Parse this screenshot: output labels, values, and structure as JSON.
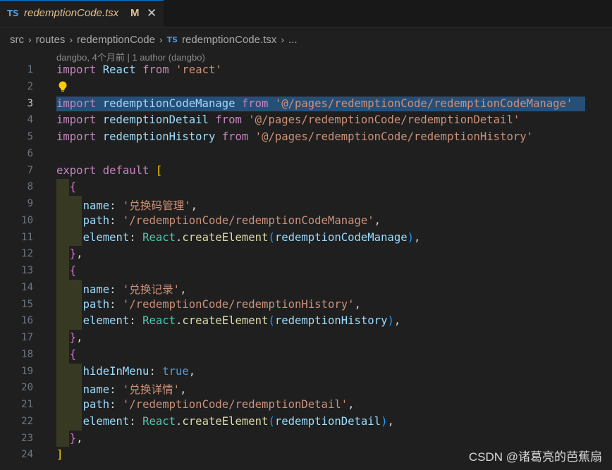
{
  "tab": {
    "lang_badge": "TS",
    "filename": "redemptionCode.tsx",
    "modified_marker": "M",
    "close_glyph": "✕",
    "icon": "close-icon"
  },
  "breadcrumb": {
    "items": [
      "src",
      "routes",
      "redemptionCode",
      "redemptionCode.tsx",
      "..."
    ],
    "file_badge": "TS"
  },
  "blame": {
    "text": "dangbo, 4个月前 | 1 author (dangbo)"
  },
  "editor": {
    "active_line": 3,
    "line_numbers": [
      "1",
      "2",
      "3",
      "4",
      "5",
      "6",
      "7",
      "8",
      "9",
      "10",
      "11",
      "12",
      "13",
      "14",
      "15",
      "16",
      "17",
      "18",
      "19",
      "20",
      "21",
      "22",
      "23",
      "24"
    ],
    "lines": [
      [
        {
          "t": "import",
          "c": "kw"
        },
        {
          "t": " "
        },
        {
          "t": "React",
          "c": "id"
        },
        {
          "t": " "
        },
        {
          "t": "from",
          "c": "kw"
        },
        {
          "t": " "
        },
        {
          "t": "'react'",
          "c": "str"
        }
      ],
      [],
      [
        {
          "t": "import",
          "c": "kw"
        },
        {
          "t": " "
        },
        {
          "t": "redemptionCodeManage",
          "c": "id"
        },
        {
          "t": " "
        },
        {
          "t": "from",
          "c": "kw"
        },
        {
          "t": " "
        },
        {
          "t": "'@/pages/redemptionCode/redemptionCodeManage'",
          "c": "str"
        }
      ],
      [
        {
          "t": "import",
          "c": "kw"
        },
        {
          "t": " "
        },
        {
          "t": "redemptionDetail",
          "c": "id"
        },
        {
          "t": " "
        },
        {
          "t": "from",
          "c": "kw"
        },
        {
          "t": " "
        },
        {
          "t": "'@/pages/redemptionCode/redemptionDetail'",
          "c": "str"
        }
      ],
      [
        {
          "t": "import",
          "c": "kw"
        },
        {
          "t": " "
        },
        {
          "t": "redemptionHistory",
          "c": "id"
        },
        {
          "t": " "
        },
        {
          "t": "from",
          "c": "kw"
        },
        {
          "t": " "
        },
        {
          "t": "'@/pages/redemptionCode/redemptionHistory'",
          "c": "str"
        }
      ],
      [],
      [
        {
          "t": "export",
          "c": "kw"
        },
        {
          "t": " "
        },
        {
          "t": "default",
          "c": "kw"
        },
        {
          "t": " "
        },
        {
          "t": "[",
          "c": "br1"
        }
      ],
      [
        {
          "t": "  "
        },
        {
          "t": "{",
          "c": "br2"
        }
      ],
      [
        {
          "t": "    "
        },
        {
          "t": "name",
          "c": "id"
        },
        {
          "t": ": "
        },
        {
          "t": "'兑换码管理'",
          "c": "str"
        },
        {
          "t": ","
        }
      ],
      [
        {
          "t": "    "
        },
        {
          "t": "path",
          "c": "id"
        },
        {
          "t": ": "
        },
        {
          "t": "'/redemptionCode/redemptionCodeManage'",
          "c": "str"
        },
        {
          "t": ","
        }
      ],
      [
        {
          "t": "    "
        },
        {
          "t": "element",
          "c": "id"
        },
        {
          "t": ": "
        },
        {
          "t": "React",
          "c": "cls"
        },
        {
          "t": "."
        },
        {
          "t": "createElement",
          "c": "fn"
        },
        {
          "t": "(",
          "c": "br3"
        },
        {
          "t": "redemptionCodeManage",
          "c": "id"
        },
        {
          "t": ")",
          "c": "br3"
        },
        {
          "t": ","
        }
      ],
      [
        {
          "t": "  "
        },
        {
          "t": "}",
          "c": "br2"
        },
        {
          "t": ","
        }
      ],
      [
        {
          "t": "  "
        },
        {
          "t": "{",
          "c": "br2"
        }
      ],
      [
        {
          "t": "    "
        },
        {
          "t": "name",
          "c": "id"
        },
        {
          "t": ": "
        },
        {
          "t": "'兑换记录'",
          "c": "str"
        },
        {
          "t": ","
        }
      ],
      [
        {
          "t": "    "
        },
        {
          "t": "path",
          "c": "id"
        },
        {
          "t": ": "
        },
        {
          "t": "'/redemptionCode/redemptionHistory'",
          "c": "str"
        },
        {
          "t": ","
        }
      ],
      [
        {
          "t": "    "
        },
        {
          "t": "element",
          "c": "id"
        },
        {
          "t": ": "
        },
        {
          "t": "React",
          "c": "cls"
        },
        {
          "t": "."
        },
        {
          "t": "createElement",
          "c": "fn"
        },
        {
          "t": "(",
          "c": "br3"
        },
        {
          "t": "redemptionHistory",
          "c": "id"
        },
        {
          "t": ")",
          "c": "br3"
        },
        {
          "t": ","
        }
      ],
      [
        {
          "t": "  "
        },
        {
          "t": "}",
          "c": "br2"
        },
        {
          "t": ","
        }
      ],
      [
        {
          "t": "  "
        },
        {
          "t": "{",
          "c": "br2"
        }
      ],
      [
        {
          "t": "    "
        },
        {
          "t": "hideInMenu",
          "c": "id"
        },
        {
          "t": ": "
        },
        {
          "t": "true",
          "c": "kw2"
        },
        {
          "t": ","
        }
      ],
      [
        {
          "t": "    "
        },
        {
          "t": "name",
          "c": "id"
        },
        {
          "t": ": "
        },
        {
          "t": "'兑换详情'",
          "c": "str"
        },
        {
          "t": ","
        }
      ],
      [
        {
          "t": "    "
        },
        {
          "t": "path",
          "c": "id"
        },
        {
          "t": ": "
        },
        {
          "t": "'/redemptionCode/redemptionDetail'",
          "c": "str"
        },
        {
          "t": ","
        }
      ],
      [
        {
          "t": "    "
        },
        {
          "t": "element",
          "c": "id"
        },
        {
          "t": ": "
        },
        {
          "t": "React",
          "c": "cls"
        },
        {
          "t": "."
        },
        {
          "t": "createElement",
          "c": "fn"
        },
        {
          "t": "(",
          "c": "br3"
        },
        {
          "t": "redemptionDetail",
          "c": "id"
        },
        {
          "t": ")",
          "c": "br3"
        },
        {
          "t": ","
        }
      ],
      [
        {
          "t": "  "
        },
        {
          "t": "}",
          "c": "br2"
        },
        {
          "t": ","
        }
      ],
      [
        {
          "t": "]",
          "c": "br1"
        }
      ]
    ]
  },
  "lightbulb": {
    "icon": "lightbulb-icon",
    "color": "#ffcc00"
  },
  "watermark": {
    "text": "CSDN @诸葛亮的芭蕉扇"
  },
  "colors": {
    "accent": "#0078d4",
    "keyword": "#c586c0",
    "string": "#ce9178",
    "identifier": "#9cdcfe",
    "selection": "#264f78"
  }
}
